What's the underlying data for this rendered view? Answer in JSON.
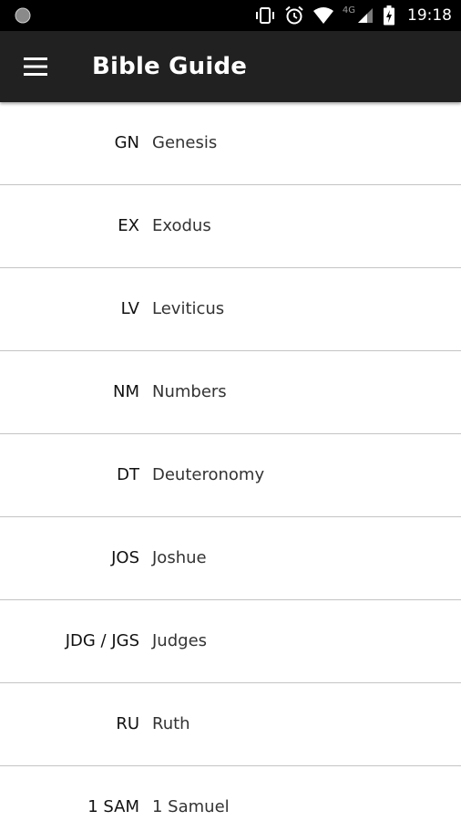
{
  "status_bar": {
    "time": "19:18",
    "network_type": "4G",
    "icons": [
      "notification-dot-icon",
      "vibrate-icon",
      "alarm-icon",
      "wifi-icon",
      "cellular-signal-icon",
      "battery-charging-icon"
    ]
  },
  "app_bar": {
    "menu_icon": "hamburger-menu-icon",
    "title": "Bible Guide"
  },
  "books": [
    {
      "abbr": "GN",
      "name": "Genesis"
    },
    {
      "abbr": "EX",
      "name": "Exodus"
    },
    {
      "abbr": "LV",
      "name": "Leviticus"
    },
    {
      "abbr": "NM",
      "name": "Numbers"
    },
    {
      "abbr": "DT",
      "name": "Deuteronomy"
    },
    {
      "abbr": "JOS",
      "name": "Joshue"
    },
    {
      "abbr": "JDG / JGS",
      "name": "Judges"
    },
    {
      "abbr": "RU",
      "name": "Ruth"
    },
    {
      "abbr": "1 SAM",
      "name": "1 Samuel"
    }
  ]
}
